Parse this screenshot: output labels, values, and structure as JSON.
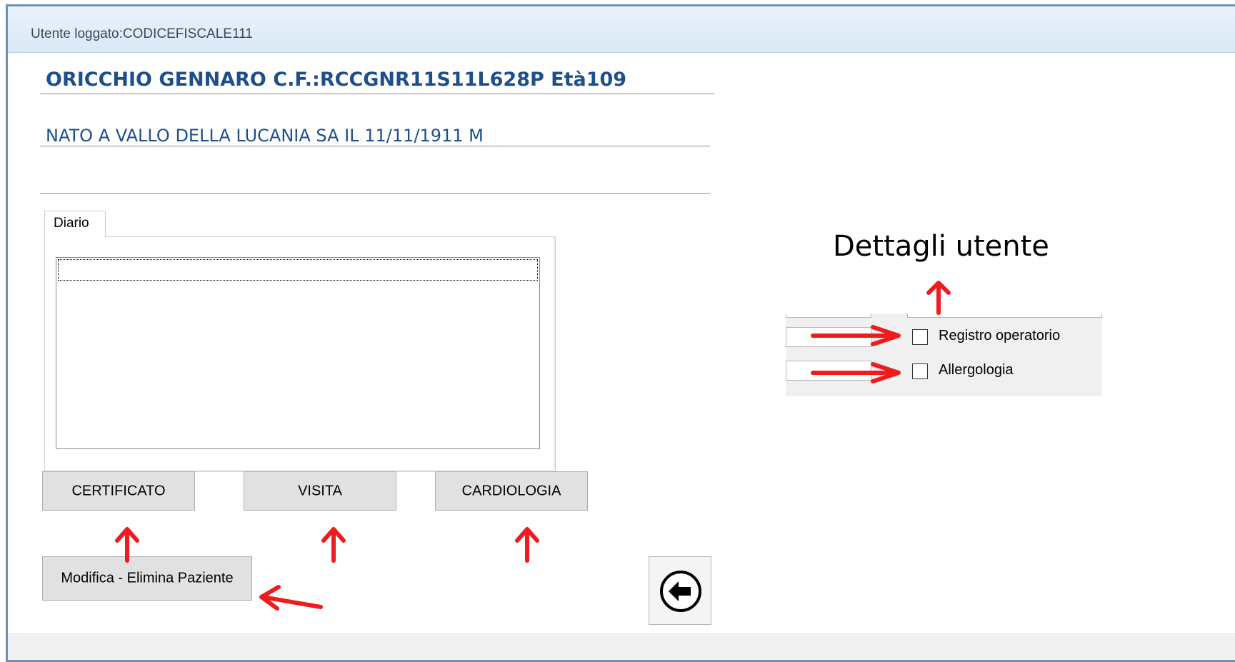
{
  "titlebar": {
    "text": "Utente loggato:CODICEFISCALE111"
  },
  "patient": {
    "name_line": "ORICCHIO GENNARO C.F.:RCCGNR11S11L628P Età109",
    "birth_line": "NATO A VALLO DELLA LUCANIA SA IL 11/11/1911 M"
  },
  "tabs": [
    {
      "label": "Diario"
    }
  ],
  "buttons": {
    "certificato": "CERTIFICATO",
    "visita": "VISITA",
    "cardiologia": "CARDIOLOGIA",
    "modifica": "Modifica - Elimina Paziente"
  },
  "back_button": {
    "icon": "arrow-left-circle-icon"
  },
  "checkboxes": [
    {
      "label": "Registro operatorio",
      "checked": false
    },
    {
      "label": "Allergologia",
      "checked": false
    }
  ],
  "annotation": {
    "label": "Dettagli utente",
    "arrow_color": "#ee1c1c"
  },
  "colors": {
    "header_text": "#1d4f8c",
    "window_border": "#6e91b8",
    "titlebar_bg": "#e3eef9",
    "button_bg": "#e1e1e1"
  }
}
